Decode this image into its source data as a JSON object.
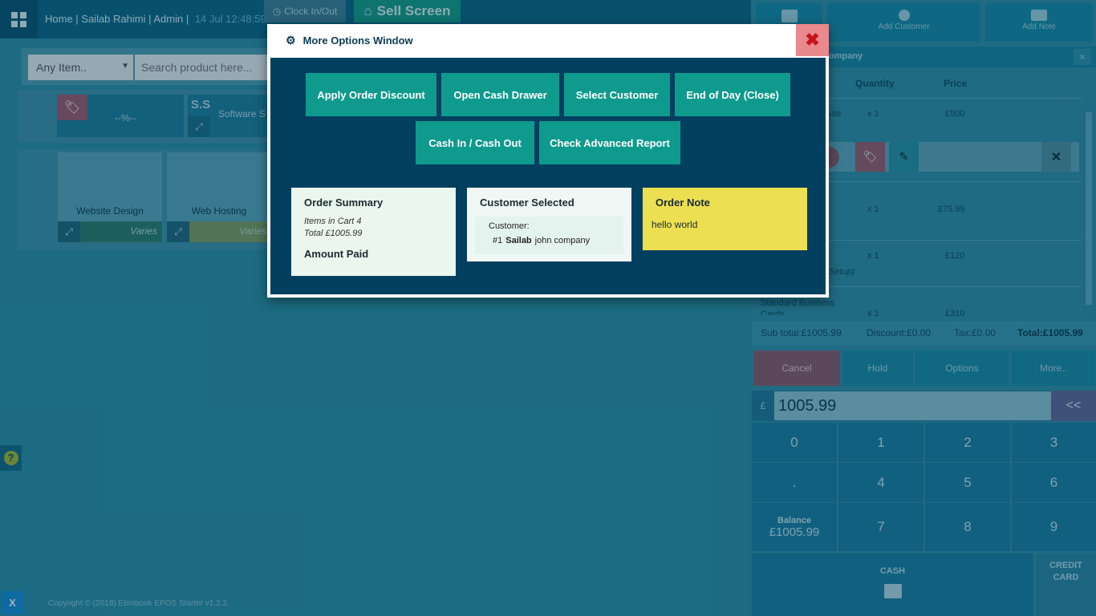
{
  "topbar": {
    "breadcrumb": "Home | Sailab Rahimi | Admin |",
    "time": "14 Jul 12:48:59",
    "clock_label": "Clock In/Out",
    "sell_label": "Sell Screen"
  },
  "search": {
    "category_select": "Any Item..",
    "placeholder": "Search product here..."
  },
  "categories": [
    {
      "label": "--%--"
    },
    {
      "abbr": "S.S",
      "label": "Software S"
    }
  ],
  "products": [
    {
      "name": "Website Design",
      "price": "Varies"
    },
    {
      "name": "Web Hosting",
      "price": "Varies"
    }
  ],
  "right_panel": {
    "add_customer": "Add Customer",
    "add_note": "Add Note",
    "customer_bar": "ompany",
    "headers": {
      "quantity": "Quantity",
      "price": "Price"
    },
    "items": [
      {
        "name": "bsite",
        "qty": "x 1",
        "price": "£500"
      },
      {
        "name": "",
        "qty": "x 1",
        "price": "£75.99"
      },
      {
        "name": "Setup)",
        "qty": "x 1",
        "price": "£120"
      },
      {
        "name": "Standard Business Cards",
        "qty": "x 1",
        "price": "£310"
      }
    ],
    "totals": {
      "subtotal": "Sub total:£1005.99",
      "discount": "Discount:£0.00",
      "tax": "Tax:£0.00",
      "total": "Total:£1005.99"
    },
    "actions": {
      "cancel": "Cancel",
      "hold": "Hold",
      "options": "Options",
      "more": "More.."
    },
    "amount": {
      "currency": "£",
      "value": "1005.99",
      "back": "<<"
    },
    "keys": [
      "0",
      "1",
      "2",
      "3",
      ".",
      "4",
      "5",
      "6",
      "7",
      "8",
      "9"
    ],
    "balance": {
      "label": "Balance",
      "value": "£1005.99"
    },
    "cash": "CASH",
    "credit": "CREDIT CARD"
  },
  "footer": {
    "copyright": "Copyright © (2018) Ebmbook EPOS Starter v1.2.2.",
    "x_label": "X",
    "help": "?"
  },
  "modal": {
    "title": "More Options Window",
    "buttons": {
      "apply_discount": "Apply Order Discount",
      "open_drawer": "Open Cash Drawer",
      "select_customer": "Select Customer",
      "end_of_day": "End of Day (Close)",
      "cash_in_out": "Cash In / Cash Out",
      "advanced_report": "Check Advanced Report"
    },
    "summary": {
      "title": "Order Summary",
      "items": "Items in Cart  4",
      "total": "Total  £1005.99",
      "amount_paid": "Amount Paid"
    },
    "customer": {
      "title": "Customer Selected",
      "label": "Customer:",
      "id": "#1",
      "name": "Sailab",
      "company": "john company"
    },
    "note": {
      "title": "Order Note",
      "text": "hello world"
    }
  },
  "colors": {
    "modal_body": "#033f5e",
    "button_teal": "#0f9a8e",
    "note_yellow": "#ecdf52",
    "close_red": "#e9898e"
  }
}
